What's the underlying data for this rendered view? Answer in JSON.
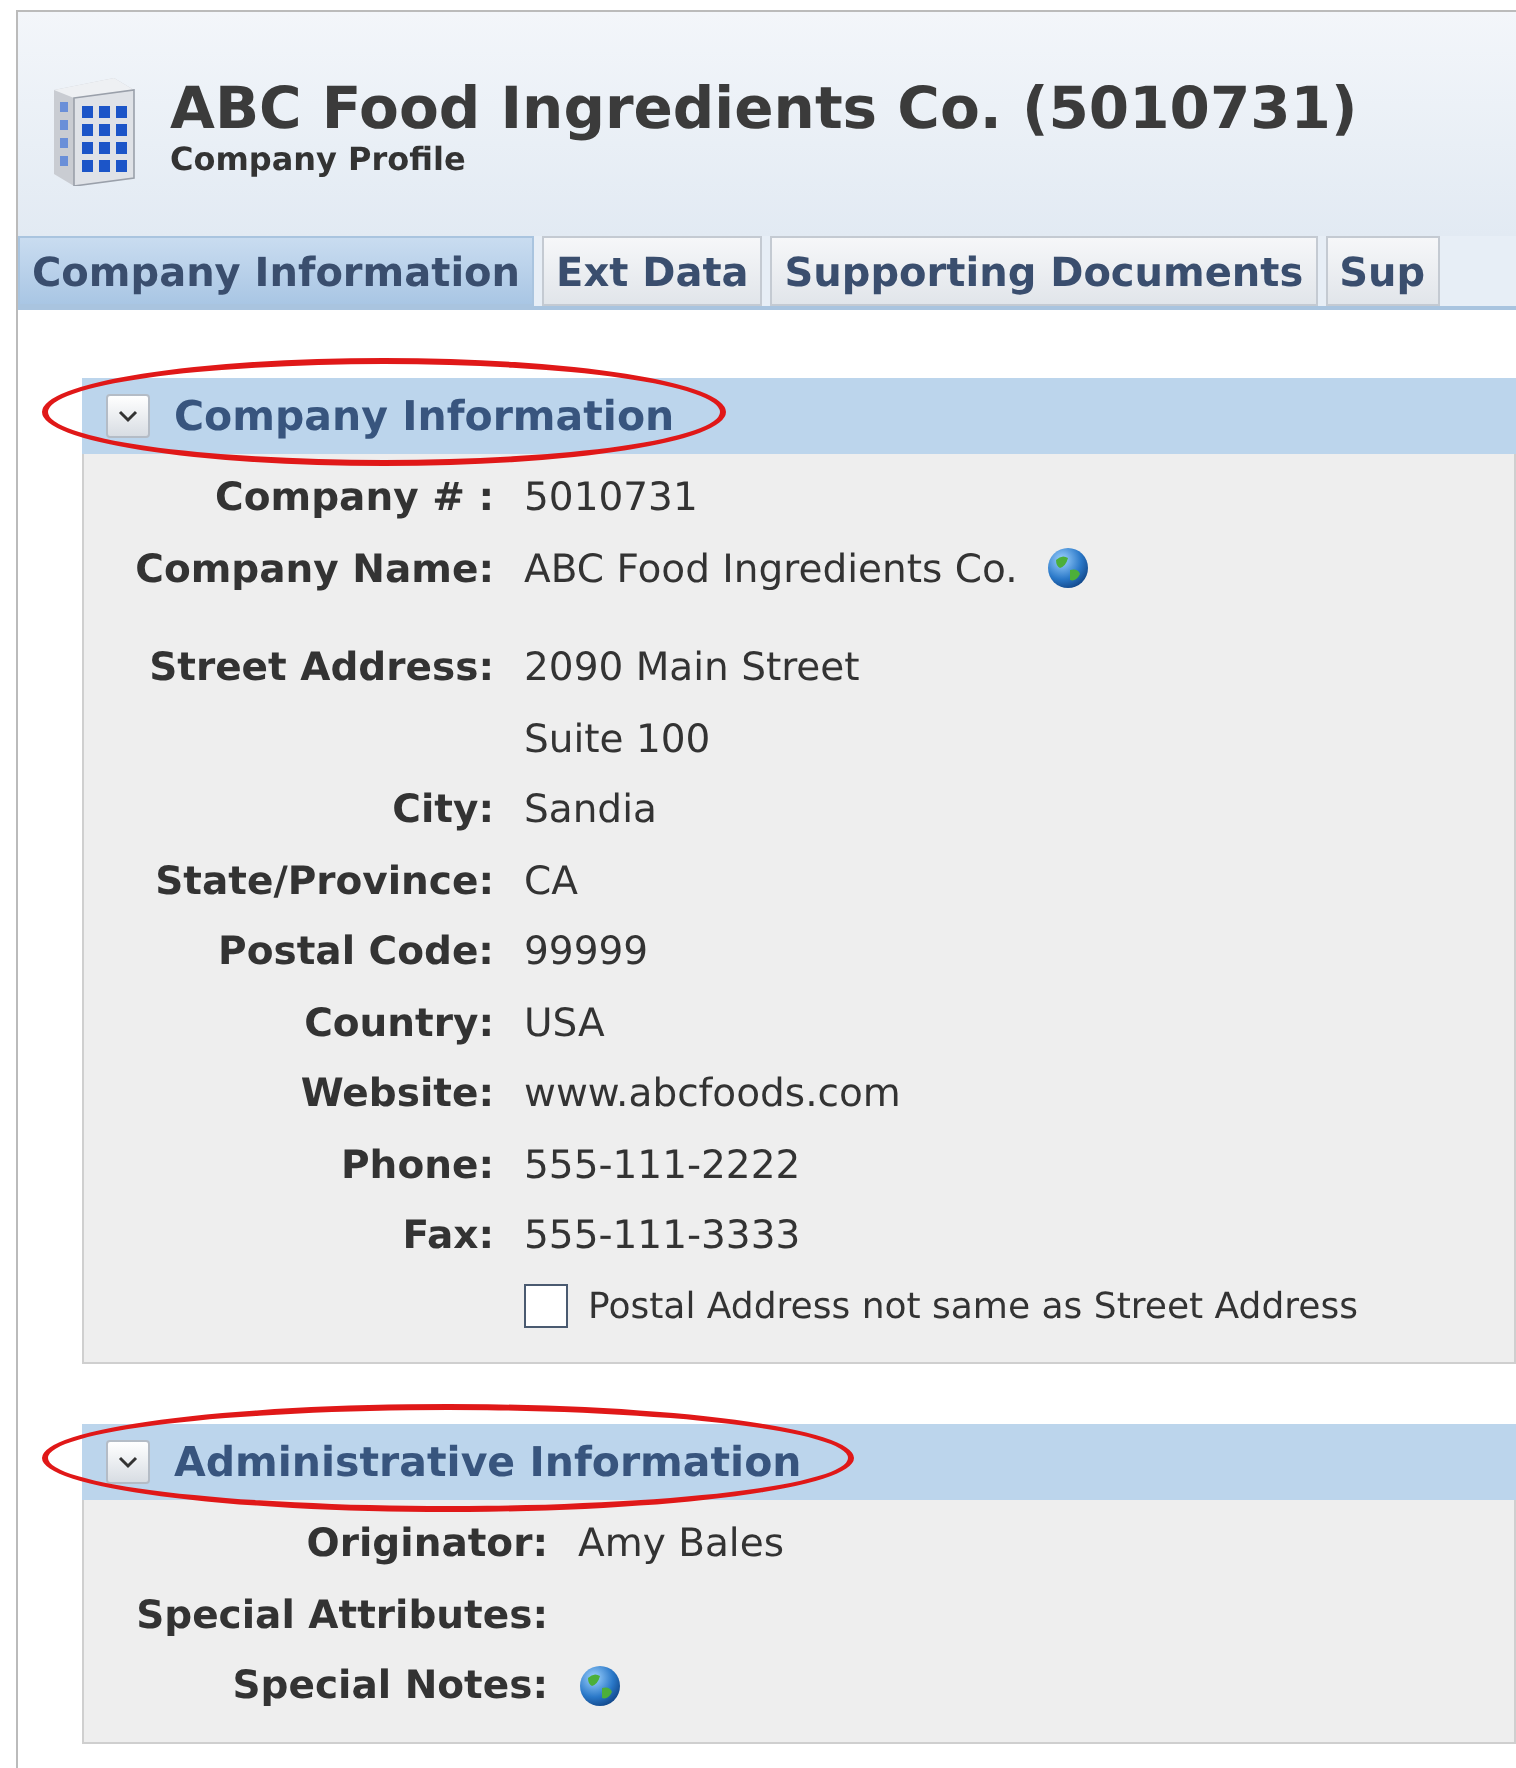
{
  "header": {
    "title": "ABC Food Ingredients Co. (5010731)",
    "subtitle": "Company Profile"
  },
  "tabs": [
    {
      "label": "Company Information",
      "selected": true
    },
    {
      "label": "Ext Data",
      "selected": false
    },
    {
      "label": "Supporting Documents",
      "selected": false
    },
    {
      "label": "Sup",
      "selected": false
    }
  ],
  "sections": [
    {
      "title": "Company Information",
      "expanded": true,
      "highlighted": true,
      "rows": [
        {
          "label": "Company # :",
          "value": "5010731",
          "globe": false
        },
        {
          "label": "Company Name:",
          "value": "ABC Food Ingredients Co.",
          "globe": true
        },
        {
          "label": "Street Address:",
          "value": "2090 Main Street",
          "globe": false,
          "gap_before": true
        },
        {
          "label": "",
          "value": "Suite 100",
          "globe": false
        },
        {
          "label": "City:",
          "value": "Sandia",
          "globe": false
        },
        {
          "label": "State/Province:",
          "value": "CA",
          "globe": false
        },
        {
          "label": "Postal Code:",
          "value": "99999",
          "globe": false
        },
        {
          "label": "Country:",
          "value": "USA",
          "globe": false
        },
        {
          "label": "Website:",
          "value": "www.abcfoods.com",
          "globe": false
        },
        {
          "label": "Phone:",
          "value": "555-111-2222",
          "globe": false
        },
        {
          "label": "Fax:",
          "value": "555-111-3333",
          "globe": false
        }
      ],
      "checkbox": {
        "label": "Postal Address not same as Street Address",
        "checked": false
      }
    },
    {
      "title": "Administrative Information",
      "expanded": true,
      "highlighted": true,
      "rows": [
        {
          "label": "Originator:",
          "value": "Amy Bales",
          "globe": false
        },
        {
          "label": "Special Attributes:",
          "globe": false
        },
        {
          "label": "Special Notes:",
          "globe": true
        }
      ]
    }
  ]
}
